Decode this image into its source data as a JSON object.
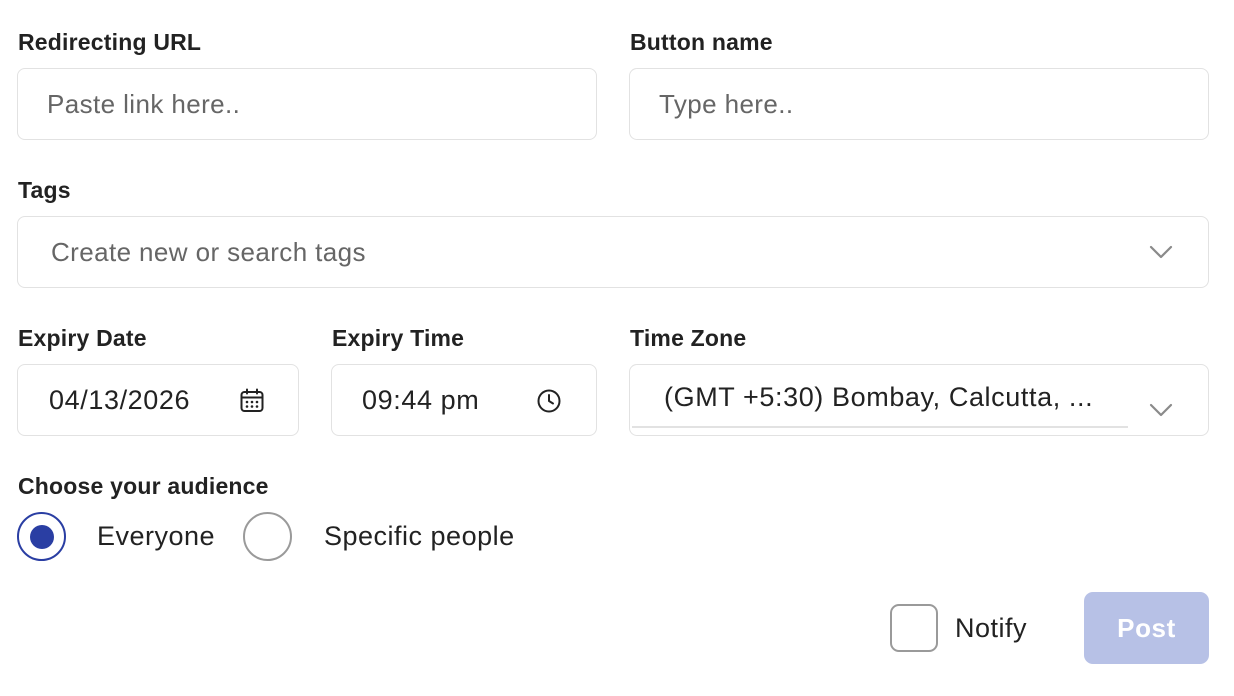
{
  "form": {
    "redirect_url": {
      "label": "Redirecting URL",
      "value": "",
      "placeholder": "Paste link here.."
    },
    "button_name": {
      "label": "Button name",
      "value": "",
      "placeholder": "Type here.."
    },
    "tags": {
      "label": "Tags",
      "value": "",
      "placeholder": "Create new or search tags",
      "icon": "chevron-down-icon"
    },
    "expiry_date": {
      "label": "Expiry Date",
      "value": "04/13/2026",
      "icon": "calendar-icon"
    },
    "expiry_time": {
      "label": "Expiry Time",
      "value": "09:44 pm",
      "icon": "clock-icon"
    },
    "time_zone": {
      "label": "Time Zone",
      "value": "(GMT +5:30) Bombay, Calcutta, ...",
      "icon": "chevron-down-icon"
    },
    "audience": {
      "label": "Choose your audience",
      "options": [
        {
          "label": "Everyone",
          "selected": true
        },
        {
          "label": "Specific people",
          "selected": false
        }
      ]
    },
    "notify": {
      "label": "Notify",
      "checked": false
    },
    "post_button": {
      "label": "Post",
      "disabled": true
    }
  },
  "colors": {
    "accent": "#2a3ea3",
    "post_button_disabled": "#b7c1e6",
    "border": "#e2e2e2",
    "radio_unselected_border": "#9a9a9a"
  }
}
